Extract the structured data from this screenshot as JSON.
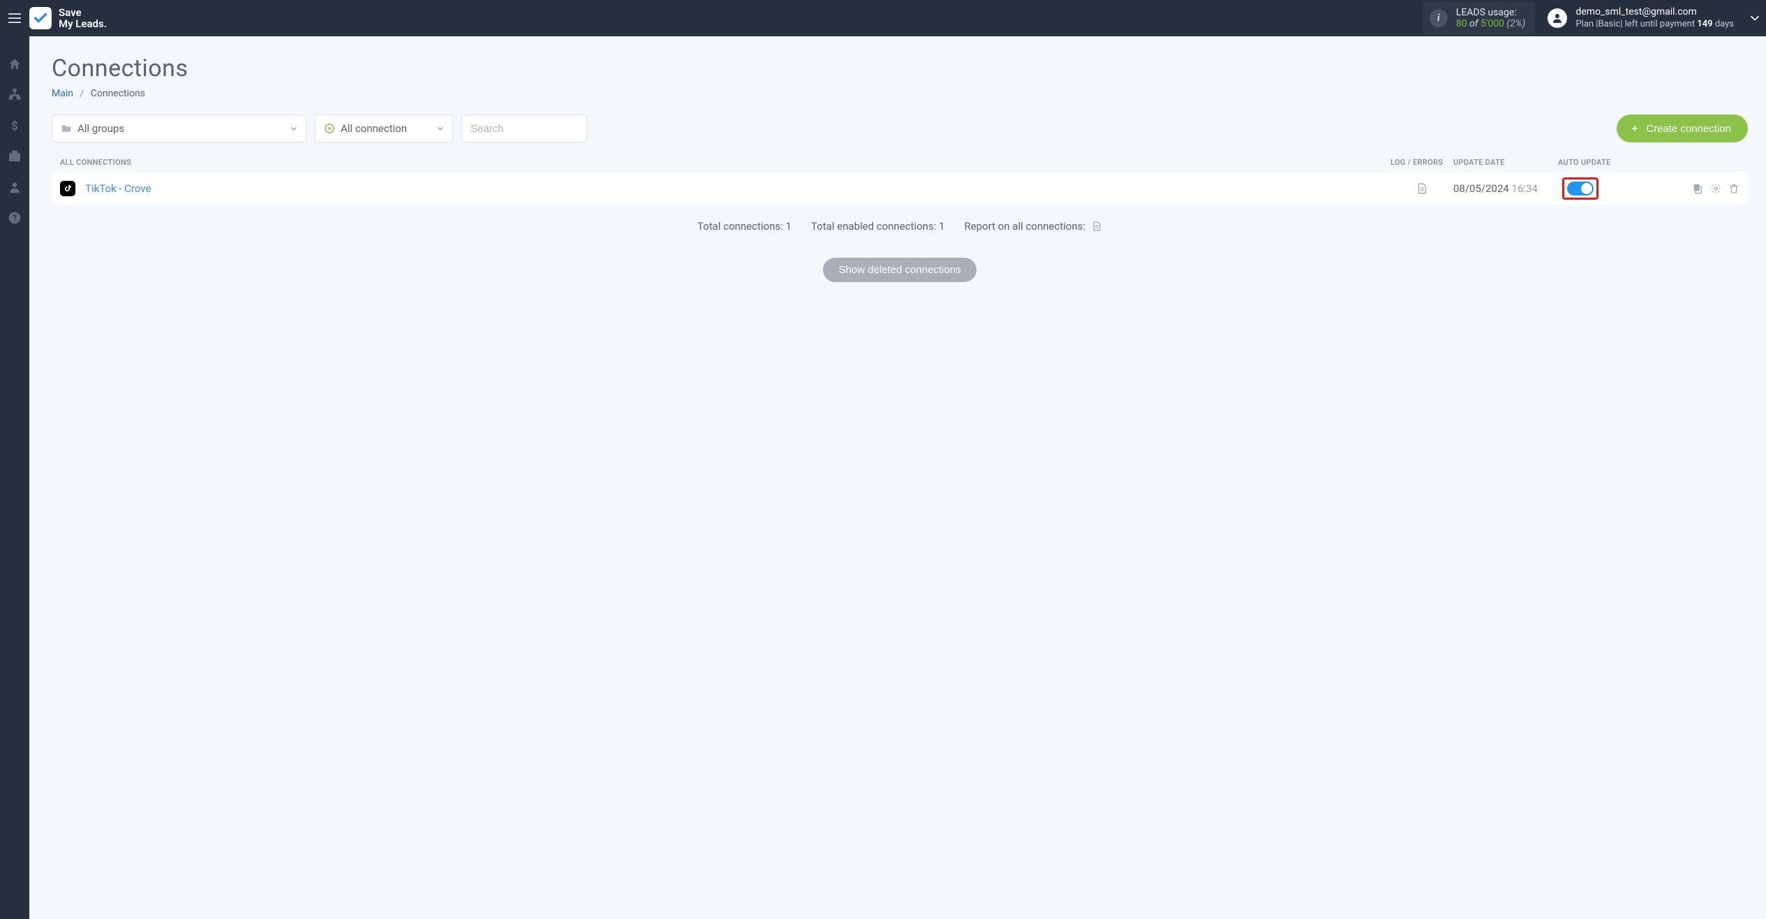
{
  "app": {
    "logo_line1": "Save",
    "logo_line2": "My Leads."
  },
  "usage": {
    "label": "LEADS usage:",
    "used": "80",
    "of": "of",
    "total": "5'000",
    "pct": "(2%)"
  },
  "account": {
    "email": "demo_sml_test@gmail.com",
    "plan_prefix": "Plan |",
    "plan_name": "Basic",
    "plan_mid": "| left until payment ",
    "days_num": "149",
    "days_word": " days"
  },
  "nav": {
    "items": [
      "home",
      "connections",
      "billing",
      "tools",
      "profile",
      "help"
    ]
  },
  "page": {
    "title": "Connections",
    "breadcrumb_main": "Main",
    "breadcrumb_sep": "/",
    "breadcrumb_current": "Connections",
    "groups_select": "All groups",
    "status_select": "All connection",
    "search_placeholder": "Search",
    "create_button": "Create connection",
    "table_header_connections": "ALL CONNECTIONS",
    "table_header_log": "LOG / ERRORS",
    "table_header_update": "UPDATE DATE",
    "table_header_auto": "AUTO UPDATE"
  },
  "connections": [
    {
      "icon": "tiktok",
      "name": "TikTok - Crove",
      "update_date": "08/05/2024",
      "update_time": "16:34",
      "auto_update": true
    }
  ],
  "summary": {
    "total_label": "Total connections: ",
    "total_count": "1",
    "enabled_label": "Total enabled connections: ",
    "enabled_count": "1",
    "report_label": "Report on all connections: "
  },
  "deleted": {
    "button": "Show deleted connections"
  }
}
